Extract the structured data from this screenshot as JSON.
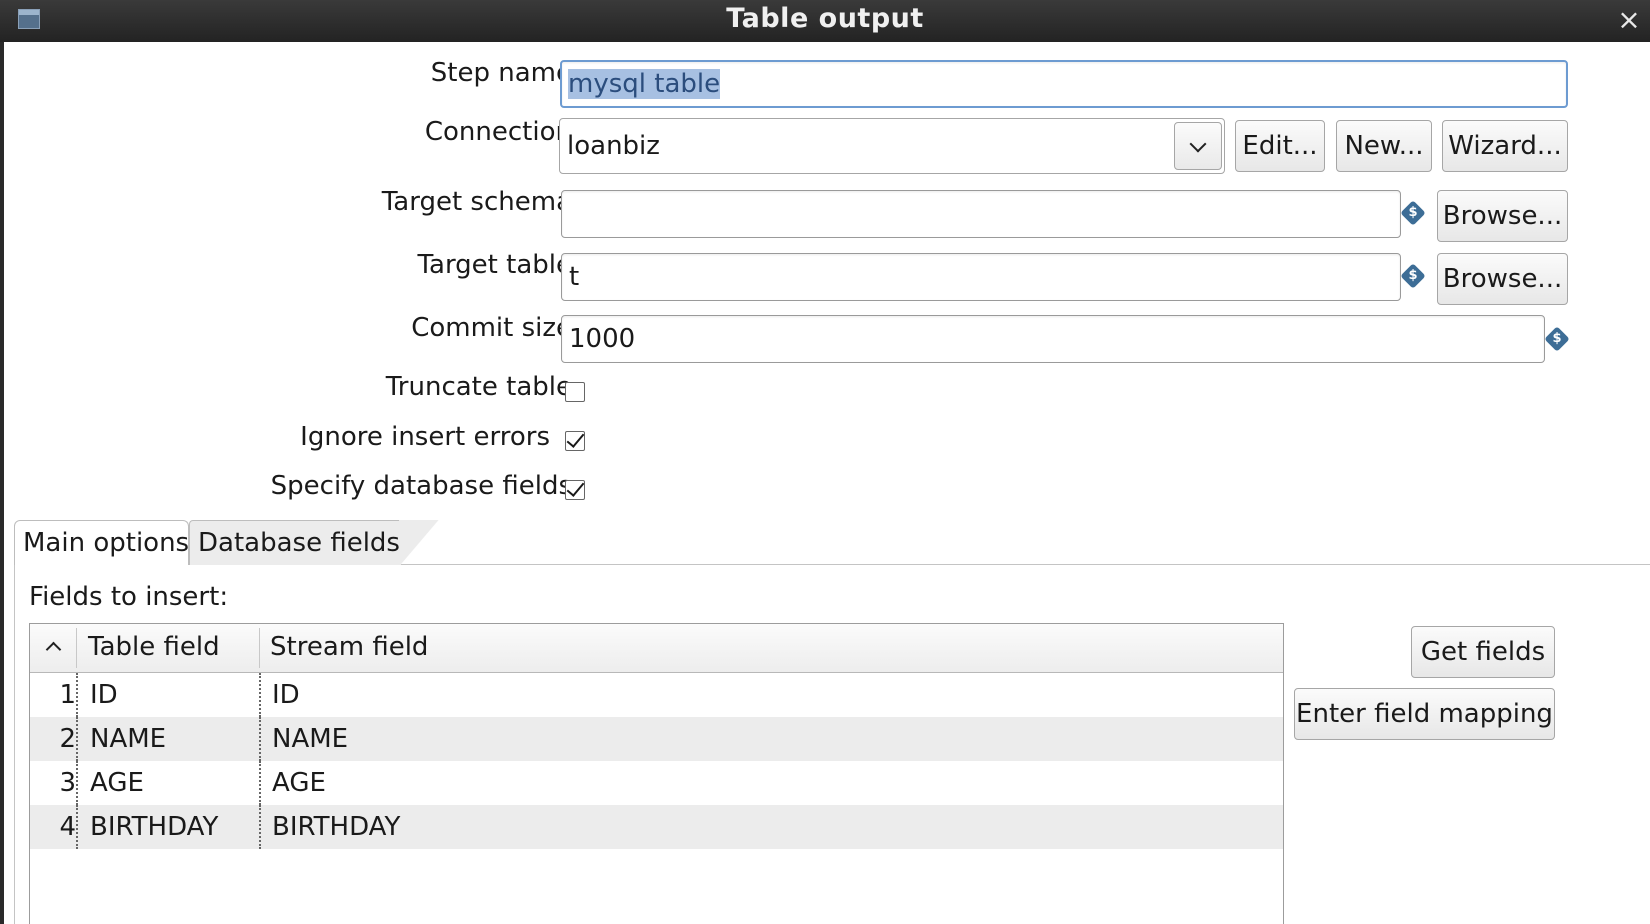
{
  "window": {
    "title": "Table output",
    "close_glyph": "×"
  },
  "form": {
    "step_name": {
      "label": "Step name",
      "value": "mysql table"
    },
    "connection": {
      "label": "Connection",
      "value": "loanbiz",
      "edit_label": "Edit...",
      "new_label": "New...",
      "wizard_label": "Wizard..."
    },
    "target_schema": {
      "label": "Target schema",
      "value": "",
      "browse_label": "Browse..."
    },
    "target_table": {
      "label": "Target table",
      "value": "t",
      "browse_label": "Browse..."
    },
    "commit_size": {
      "label": "Commit size",
      "value": "1000"
    },
    "truncate_table": {
      "label": "Truncate table",
      "checked": false
    },
    "ignore_insert_errors": {
      "label": "Ignore insert errors",
      "checked": true
    },
    "specify_database_fields": {
      "label": "Specify database fields",
      "checked": true
    }
  },
  "variable_icon_glyph": "$",
  "tabs": [
    {
      "label": "Main options"
    },
    {
      "label": "Database fields",
      "active": true
    }
  ],
  "fields_panel": {
    "title": "Fields to insert:",
    "columns": [
      "Table field",
      "Stream field"
    ],
    "rows": [
      {
        "num": "1",
        "table_field": "ID",
        "stream_field": "ID"
      },
      {
        "num": "2",
        "table_field": "NAME",
        "stream_field": "NAME"
      },
      {
        "num": "3",
        "table_field": "AGE",
        "stream_field": "AGE"
      },
      {
        "num": "4",
        "table_field": "BIRTHDAY",
        "stream_field": "BIRTHDAY"
      }
    ],
    "get_fields_label": "Get fields",
    "enter_mapping_label": "Enter field mapping"
  }
}
